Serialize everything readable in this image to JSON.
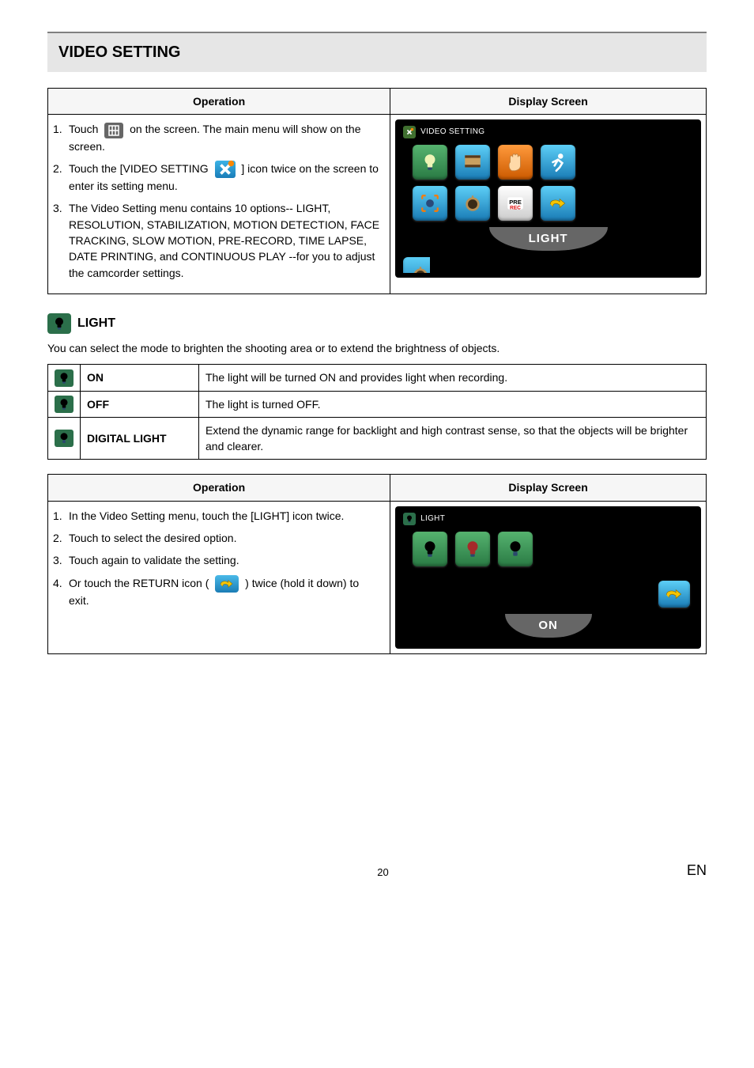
{
  "section_title": "VIDEO SETTING",
  "table1": {
    "head_op": "Operation",
    "head_ds": "Display Screen",
    "steps": [
      {
        "n": "1.",
        "pre": "Touch ",
        "post": " on the screen. The main menu will show on the screen."
      },
      {
        "n": "2.",
        "pre": "Touch the [VIDEO SETTING ",
        "post": " ] icon twice on the screen to enter its setting menu."
      },
      {
        "n": "3.",
        "text": "The Video Setting menu contains 10 options-- LIGHT, RESOLUTION, STABILIZATION, MOTION DETECTION, FACE TRACKING, SLOW MOTION, PRE-RECORD, TIME LAPSE, DATE PRINTING, and CONTINUOUS PLAY --for you to adjust the camcorder settings."
      }
    ],
    "screen": {
      "title": "VIDEO SETTING",
      "curved_label": "LIGHT",
      "icons_row1": [
        "light-icon",
        "resolution-icon",
        "stabilization-icon",
        "motion-detection-icon"
      ],
      "icons_row2": [
        "face-tracking-icon",
        "slow-motion-icon",
        "pre-rec-icon",
        "return-icon"
      ]
    }
  },
  "light": {
    "heading": "LIGHT",
    "intro": "You can select the mode to brighten the shooting area or to extend the brightness of objects.",
    "rows": [
      {
        "name": "ON",
        "desc": "The light will be turned ON and provides light when recording."
      },
      {
        "name": "OFF",
        "desc": "The light is turned OFF."
      },
      {
        "name": "DIGITAL LIGHT",
        "desc": "Extend the dynamic range for backlight and high contrast sense, so that the objects will be brighter and clearer."
      }
    ]
  },
  "table2": {
    "head_op": "Operation",
    "head_ds": "Display Screen",
    "steps": [
      {
        "n": "1.",
        "text": "In the Video Setting menu, touch the [LIGHT] icon twice."
      },
      {
        "n": "2.",
        "text": "Touch to select the desired option."
      },
      {
        "n": "3.",
        "text": "Touch again to validate the setting."
      },
      {
        "n": "4.",
        "pre": "Or touch the RETURN icon ( ",
        "post": " ) twice (hold it down) to exit."
      }
    ],
    "screen": {
      "title": "LIGHT",
      "curved_label": "ON",
      "icons": [
        "light-on-icon",
        "light-off-icon",
        "digital-light-icon"
      ]
    }
  },
  "footer": {
    "page": "20",
    "lang": "EN"
  }
}
